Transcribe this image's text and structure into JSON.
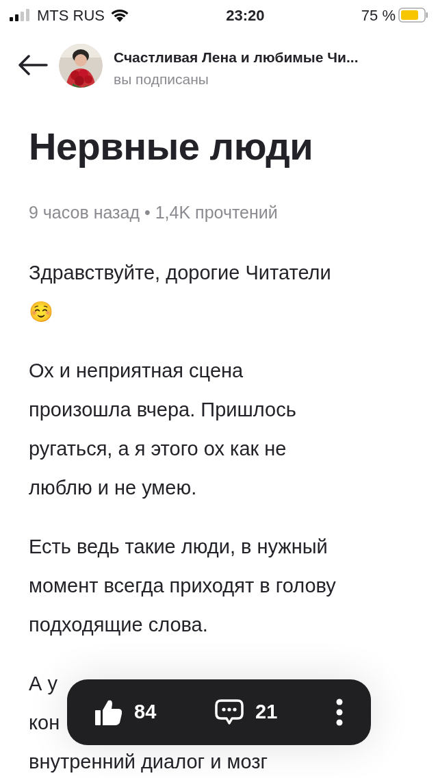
{
  "status_bar": {
    "carrier": "MTS RUS",
    "time": "23:20",
    "battery": "75 %"
  },
  "header": {
    "channel": "Счастливая Лена и любимые Чи...",
    "subtitle": "вы подписаны"
  },
  "article": {
    "title": "Нервные люди",
    "meta": "9 часов назад • 1,4K прочтений",
    "paragraphs": [
      {
        "lines": [
          "Здравствуйте, дорогие Читатели",
          "☺️"
        ]
      },
      {
        "lines": [
          "Ох и неприятная сцена",
          "произошла вчера. Пришлось",
          "ругаться, а я этого ох как не",
          "люблю и не умею."
        ]
      },
      {
        "lines": [
          "Есть ведь такие люди, в нужный",
          "момент всегда приходят в голову",
          "подходящие слова."
        ]
      },
      {
        "lines": [
          "А у",
          "кон",
          "внутренний диалог и мозг"
        ]
      }
    ]
  },
  "action_bar": {
    "likes": "84",
    "comments": "21"
  }
}
